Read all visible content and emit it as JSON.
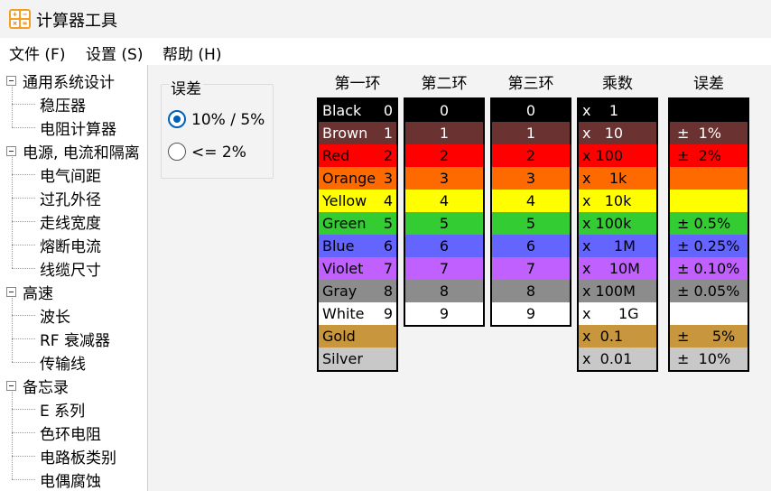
{
  "window": {
    "title": "计算器工具"
  },
  "menu": [
    "文件 (F)",
    "设置 (S)",
    "帮助 (H)"
  ],
  "tree": [
    {
      "label": "通用系统设计",
      "level": 0
    },
    {
      "label": "稳压器",
      "level": 1
    },
    {
      "label": "电阻计算器",
      "level": 1
    },
    {
      "label": "电源, 电流和隔离",
      "level": 0
    },
    {
      "label": "电气间距",
      "level": 1
    },
    {
      "label": "过孔外径",
      "level": 1
    },
    {
      "label": "走线宽度",
      "level": 1
    },
    {
      "label": "熔断电流",
      "level": 1
    },
    {
      "label": "线缆尺寸",
      "level": 1
    },
    {
      "label": "高速",
      "level": 0
    },
    {
      "label": "波长",
      "level": 1
    },
    {
      "label": "RF 衰减器",
      "level": 1
    },
    {
      "label": "传输线",
      "level": 1
    },
    {
      "label": "备忘录",
      "level": 0
    },
    {
      "label": "E 系列",
      "level": 1
    },
    {
      "label": "色环电阻",
      "level": 1,
      "selected": true
    },
    {
      "label": "电路板类别",
      "level": 1
    },
    {
      "label": "电偶腐蚀",
      "level": 1
    }
  ],
  "tolerance_group": {
    "title": "误差",
    "options": [
      {
        "label": "10% / 5%",
        "checked": true
      },
      {
        "label": "<= 2%",
        "checked": false
      }
    ]
  },
  "columns": [
    "第一环",
    "第二环",
    "第三环",
    "乘数",
    "误差"
  ],
  "colors": [
    {
      "name": "Black",
      "digit": "0",
      "bg": "#000000",
      "fg": "#ffffff"
    },
    {
      "name": "Brown",
      "digit": "1",
      "bg": "#6b3232",
      "fg": "#ffffff"
    },
    {
      "name": "Red",
      "digit": "2",
      "bg": "#ff0000",
      "fg": "#000000"
    },
    {
      "name": "Orange",
      "digit": "3",
      "bg": "#ff6a00",
      "fg": "#000000"
    },
    {
      "name": "Yellow",
      "digit": "4",
      "bg": "#ffff00",
      "fg": "#000000"
    },
    {
      "name": "Green",
      "digit": "5",
      "bg": "#33cc33",
      "fg": "#000000"
    },
    {
      "name": "Blue",
      "digit": "6",
      "bg": "#6464ff",
      "fg": "#000000"
    },
    {
      "name": "Violet",
      "digit": "7",
      "bg": "#c060ff",
      "fg": "#000000"
    },
    {
      "name": "Gray",
      "digit": "8",
      "bg": "#8c8c8c",
      "fg": "#000000"
    },
    {
      "name": "White",
      "digit": "9",
      "bg": "#ffffff",
      "fg": "#000000"
    },
    {
      "name": "Gold",
      "digit": "",
      "bg": "#c8963c",
      "fg": "#000000"
    },
    {
      "name": "Silver",
      "digit": "",
      "bg": "#c8c8c8",
      "fg": "#000000"
    }
  ],
  "multipliers": [
    "x    1",
    "x   10",
    "x 100",
    "x    1k",
    "x   10k",
    "x 100k",
    "x     1M",
    "x    10M",
    "x 100M",
    "x      1G",
    "x  0.1",
    "x  0.01"
  ],
  "tolerances": [
    "",
    "±  1%",
    "±  2%",
    "",
    "",
    "± 0.5%",
    "± 0.25%",
    "± 0.10%",
    "± 0.05%",
    "",
    "±     5%",
    "±  10%"
  ]
}
